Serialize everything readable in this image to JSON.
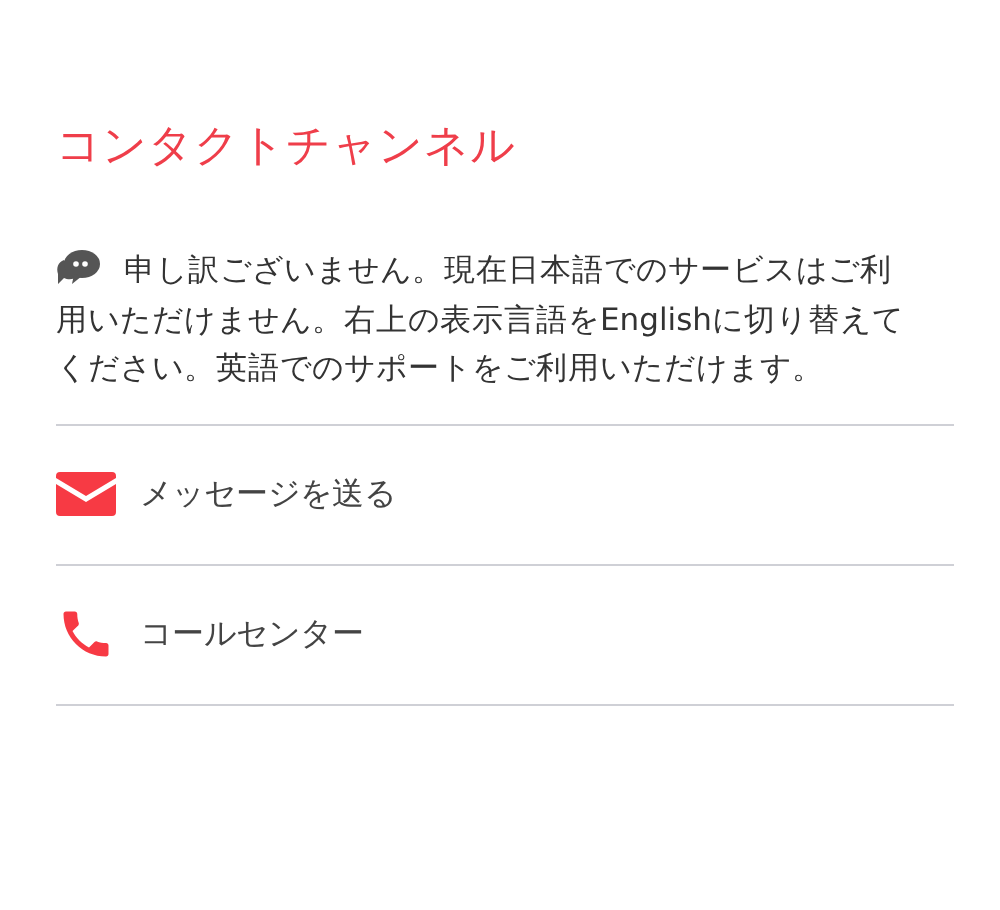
{
  "title": "コンタクトチャンネル",
  "notice": "申し訳ございません。現在日本語でのサービスはご利用いただけません。右上の表示言語をEnglishに切り替えてください。英語でのサポートをご利用いただけます。",
  "channels": [
    {
      "kind": "message",
      "label": "メッセージを送る"
    },
    {
      "kind": "phone",
      "label": "コールセンター"
    }
  ]
}
